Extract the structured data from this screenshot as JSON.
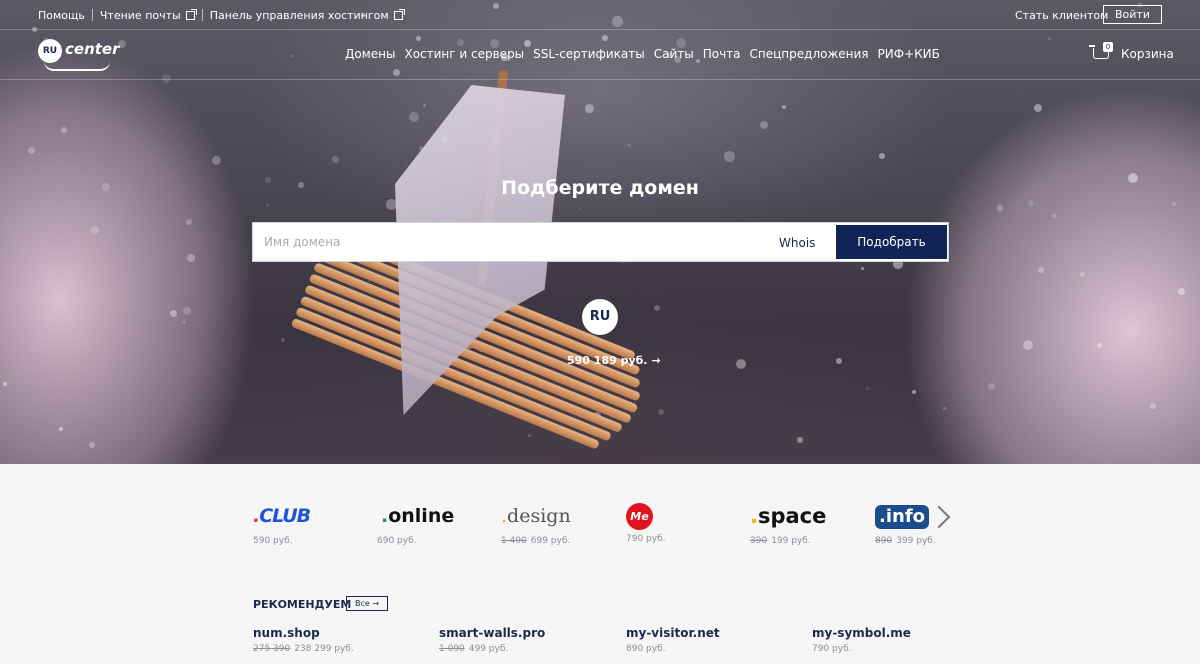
{
  "topbar": {
    "links": [
      "Помощь",
      "Чтение почты",
      "Панель управления хостингом"
    ],
    "client": "Стать клиентом",
    "login": "Войти"
  },
  "logo": {
    "ru": "RU",
    "center": "center"
  },
  "nav": {
    "items": [
      "Домены",
      "Хостинг и серверы",
      "SSL-сертификаты",
      "Сайты",
      "Почта",
      "Спецпредложения",
      "РИФ+КИБ"
    ],
    "cart_label": "Корзина",
    "cart_count": "0"
  },
  "hero": {
    "title": "Подберите домен",
    "search_placeholder": "Имя домена",
    "whois": "Whois",
    "search_button": "Подобрать",
    "zone_badge": "RU",
    "zone_price": "590 189 руб. →"
  },
  "zones": [
    {
      "dot": ".",
      "name": "CLUB",
      "old": "",
      "price": "590 руб."
    },
    {
      "dot": ".",
      "name": "online",
      "old": "",
      "price": "690 руб."
    },
    {
      "dot": ".",
      "name": "design",
      "old": "1 490",
      "price": "699 руб."
    },
    {
      "badge": "Me",
      "old": "",
      "price": "790 руб."
    },
    {
      "dot": ".",
      "name": "space",
      "old": "390",
      "price": "199 руб."
    },
    {
      "name": ".info",
      "old": "890",
      "price": "399 руб."
    }
  ],
  "recommend": {
    "title": "РЕКОМЕНДУЕМ",
    "all": "Все →",
    "items": [
      {
        "name": "num.shop",
        "old": "275 390",
        "price": "238 299 руб."
      },
      {
        "name": "smart-walls.pro",
        "old": "1 090",
        "price": "499 руб."
      },
      {
        "name": "my-visitor.net",
        "old": "",
        "price": "890 руб."
      },
      {
        "name": "my-symbol.me",
        "old": "",
        "price": "790 руб."
      }
    ]
  },
  "colors": {
    "primary": "#102457",
    "text": "#1b2a4a",
    "club": "#1d55d6",
    "me": "#e0141e",
    "info": "#1d4c8c"
  }
}
